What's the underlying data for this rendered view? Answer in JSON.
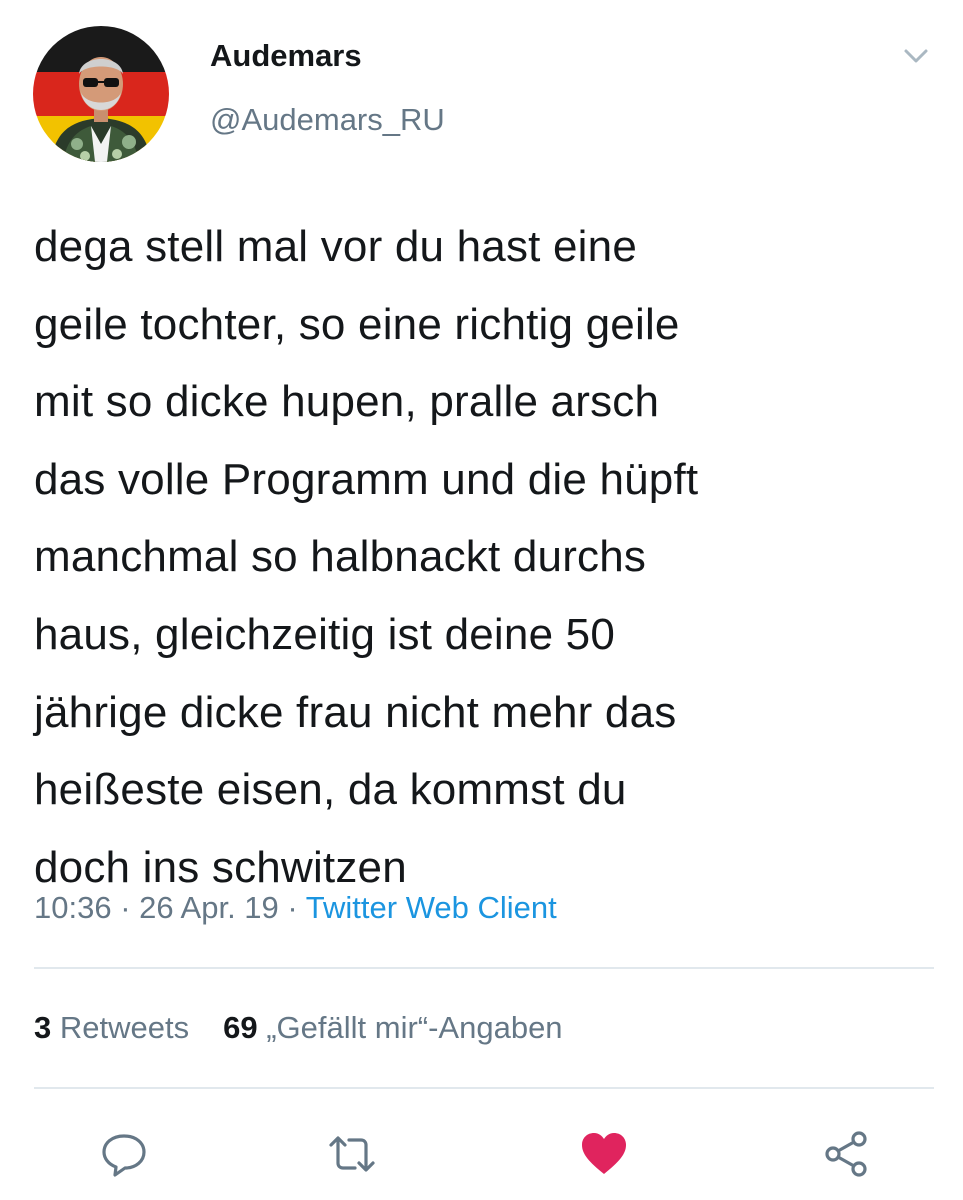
{
  "author": {
    "display_name": "Audemars",
    "handle": "@Audemars_RU",
    "avatar": "avatar-photo"
  },
  "tweet": {
    "lines": [
      "dega stell mal vor du hast eine",
      "geile tochter, so eine richtig geile",
      "mit so dicke hupen, pralle arsch",
      "das volle Programm und die hüpft",
      "manchmal so halbnackt durchs",
      "haus, gleichzeitig ist deine 50",
      "jährige dicke frau nicht mehr das",
      "heißeste eisen, da kommst du",
      "doch ins schwitzen"
    ],
    "time": "10:36",
    "date": "26 Apr. 19",
    "separator": "·",
    "client": "Twitter Web Client"
  },
  "stats": {
    "retweets_count": "3",
    "retweets_label": "Retweets",
    "likes_count": "69",
    "likes_label": "„Gefällt mir“-Angaben"
  },
  "actions": {
    "icons": [
      "reply-icon",
      "retweet-icon",
      "like-icon",
      "share-icon"
    ],
    "like_color": "#e0245e",
    "icon_color": "#657786"
  },
  "colors": {
    "link": "#1b95e0",
    "secondary_text": "#657786",
    "primary_text": "#14171a",
    "divider": "#e1e8ed"
  }
}
